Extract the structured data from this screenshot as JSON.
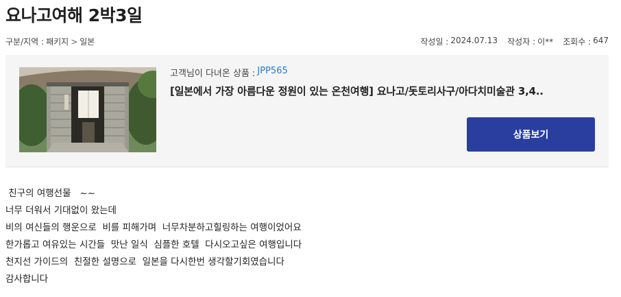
{
  "post": {
    "title": "요나고여해 2박3일"
  },
  "meta": {
    "category_label": "구분/지역 :",
    "category": "패키지",
    "separator": ">",
    "region": "일본",
    "date_label": "작성일 :",
    "date": "2024.07.13",
    "author_label": "작성자 :",
    "author": "이**",
    "views_label": "조회수 :",
    "views": "647"
  },
  "product": {
    "label": "고객님이 다녀온 상품 :",
    "code": "JPP565",
    "name": "[일본에서 가장 아름다운 정원이 있는 온천여행] 요나고/돗토리사구/아다치미술관 3,4..",
    "button_label": "상품보기",
    "image_icon": "ryokan-entrance-photo"
  },
  "review": {
    "lines": [
      " 친구의 여행선물   ~~",
      "너무 더워서 기대없이 왔는데",
      "비의 여신들의 행운으로  비를 피해가며  너무차분하고힐링하는 여행이었어요",
      "한가롭고 여유있는 시간들  맛난 일식  심플한 호텔  다시오고싶은 여행입니다",
      "천지선 가이드의  친절한 설명으로  일본을 다시한번 생각할기회였습니다",
      "감사합니다"
    ]
  },
  "colors": {
    "accent": "#2a3e9f",
    "code_link": "#2a78c6",
    "box_bg": "#f5f5f5"
  }
}
